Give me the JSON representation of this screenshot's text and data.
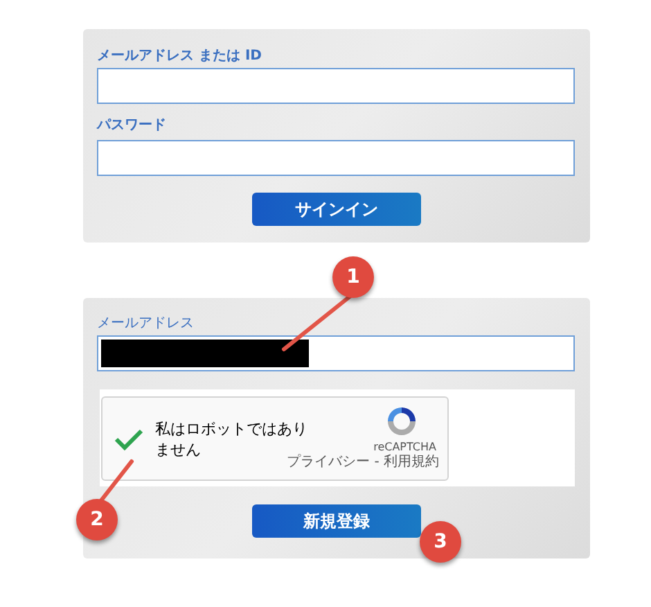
{
  "signin": {
    "fields": [
      {
        "label": "メールアドレス または ID"
      },
      {
        "label": "パスワード"
      }
    ],
    "button": "サインイン"
  },
  "register": {
    "email_label": "メールアドレス",
    "email_redacted": true,
    "captcha": {
      "checked": true,
      "label": "私はロボットではありません",
      "brand": "reCAPTCHA",
      "links": "プライバシー - 利用規約"
    },
    "button": "新規登録"
  },
  "callouts": [
    {
      "number": "1"
    },
    {
      "number": "2"
    },
    {
      "number": "3"
    }
  ]
}
